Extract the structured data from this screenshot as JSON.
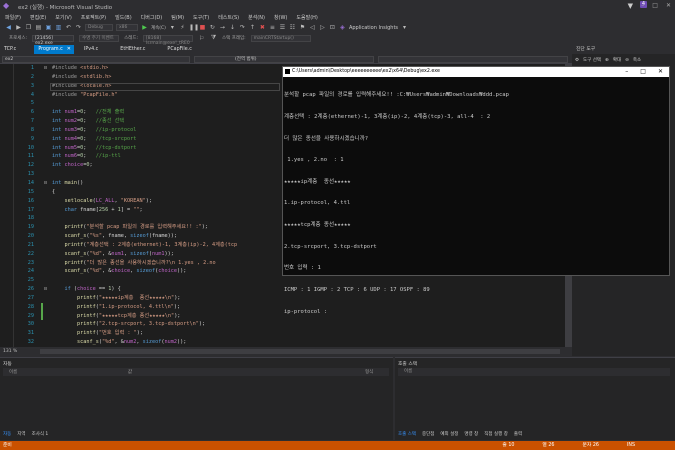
{
  "window": {
    "title": "ex2 (실행) - Microsoft Visual Studio",
    "notification_count": "4"
  },
  "menu": [
    "파일(F)",
    "편집(E)",
    "보기(V)",
    "프로젝트(P)",
    "빌드(B)",
    "디버그(D)",
    "팀(M)",
    "도구(T)",
    "테스트(S)",
    "분석(N)",
    "창(W)",
    "도움말(H)"
  ],
  "toolbar": {
    "config": "Debug",
    "platform": "x86",
    "continue_label": "계속(C)",
    "app_insights": "Application Insights"
  },
  "projbar": {
    "label": "프로세스:",
    "process": "[21456] ex2.exe",
    "lifecycle": "수명 주기 이벤트",
    "thread_label": "스레드:",
    "thread": "[8168] lsrmain@exe!_tRE0",
    "stack_label": "스택 프레임:",
    "stack": "mainCRTStartup()"
  },
  "tabs": [
    {
      "label": "TCP.c",
      "active": false
    },
    {
      "label": "Program.c",
      "active": true
    },
    {
      "label": "IPv4.c",
      "active": false
    },
    {
      "label": "EtHEther.c",
      "active": false
    },
    {
      "label": "PCapFile.c",
      "active": false
    }
  ],
  "solution_explorer": {
    "title": "진단 도구",
    "tool_select": "도구 선택",
    "zoom_in": "확대",
    "zoom_out": "축소"
  },
  "navbar": {
    "project": "ex2",
    "scope": "(전역 범위)"
  },
  "code": [
    {
      "n": "1",
      "t": "#include <stdio.h>"
    },
    {
      "n": "2",
      "t": "#include <stdlib.h>"
    },
    {
      "n": "3",
      "t": "#include <locale.h>"
    },
    {
      "n": "4",
      "t": "#include \"PcapFile.h\""
    },
    {
      "n": "5",
      "t": ""
    },
    {
      "n": "6",
      "t": "int num1=0;   //전체 출력"
    },
    {
      "n": "7",
      "t": "int num2=0;   //종선 선택"
    },
    {
      "n": "8",
      "t": "int num3=0;   //ip-protocol"
    },
    {
      "n": "9",
      "t": "int num4=0;   //tcp-srcport"
    },
    {
      "n": "10",
      "t": "int num5=0;   //tcp-dstport"
    },
    {
      "n": "11",
      "t": "int num6=0;   //ip-ttl"
    },
    {
      "n": "12",
      "t": "int choice=0;"
    },
    {
      "n": "13",
      "t": ""
    },
    {
      "n": "14",
      "t": "int main()"
    },
    {
      "n": "15",
      "t": "{"
    },
    {
      "n": "16",
      "t": "    setlocale(LC_ALL, \"KOREAN\");"
    },
    {
      "n": "17",
      "t": "    char fname[256 + 1] = \"\";"
    },
    {
      "n": "18",
      "t": ""
    },
    {
      "n": "19",
      "t": "    printf(\"분석할 pcap 파일의 경로를 입력해주세요!! :\");"
    },
    {
      "n": "20",
      "t": "    scanf_s(\"%s\", fname, sizeof(fname));"
    },
    {
      "n": "21",
      "t": "    printf(\"계층선택 : 2계층(ethernet)-1, 3계층(ip)-2, 4계층(tcp"
    },
    {
      "n": "22",
      "t": "    scanf_s(\"%d\", &num1, sizeof(num1));"
    },
    {
      "n": "23",
      "t": "    printf(\"더 많은 종선을 사용하시겠습니까?\\n 1.yes , 2.no"
    },
    {
      "n": "24",
      "t": "    scanf_s(\"%d\", &choice, sizeof(choice));"
    },
    {
      "n": "25",
      "t": ""
    },
    {
      "n": "26",
      "t": "    if (choice == 1) {"
    },
    {
      "n": "27",
      "t": "        printf(\"★★★★★ip계층  종선★★★★★\\n\");"
    },
    {
      "n": "28",
      "t": "        printf(\"1.ip-protocol, 4.ttl\\n\");"
    },
    {
      "n": "29",
      "t": "        printf(\"★★★★★tcp계층 종선★★★★★\\n\");"
    },
    {
      "n": "30",
      "t": "        printf(\"2.tcp-srcport, 3.tcp-dstport\\n\");"
    },
    {
      "n": "31",
      "t": "        printf(\"번호 입력 : \");"
    },
    {
      "n": "32",
      "t": "        scanf_s(\"%d\", &num2, sizeof(num2));"
    }
  ],
  "console": {
    "title": "C:\\Users\\admin\\Desktop\\eeeeeeeeee\\ex2\\x64\\Debug\\ex2.exe",
    "lines": [
      "분석할 pcap 파일의 경로를 입력해주세요!! :C:₩Users₩admin₩Downloads₩ddd.pcap",
      "계층선택 : 2계층(ethernet)-1, 3계층(ip)-2, 4계층(tcp)-3, all-4  : 2",
      "더 많은 종선을 사용하시겠습니까?",
      " 1.yes , 2.no  : 1",
      "★★★★★ip계층  종선★★★★★",
      "1.ip-protocol, 4.ttl",
      "★★★★★tcp계층 종선★★★★★",
      "2.tcp-srcport, 3.tcp-dstport",
      "번호 입력 : 1",
      "ICMP : 1 IGMP : 2 TCP : 6 UDP : 17 OSPF : 89",
      "ip-protocol : "
    ]
  },
  "editor_zoom": "131 %",
  "errors_panel": {
    "title": "자동",
    "col_name": "이름",
    "col_value": "값",
    "col_type": "형식",
    "tabs": [
      "자동",
      "지역",
      "조사식 1"
    ]
  },
  "output_panel": {
    "title": "호출 스택",
    "col_name": "이름",
    "tabs": [
      "호출 스택",
      "중단점",
      "예외 설정",
      "명령 창",
      "직접 실행 창",
      "출력"
    ]
  },
  "statusbar": {
    "left": "준비",
    "line": "줄 10",
    "col": "열 26",
    "ch": "문자 26",
    "mode": "INS"
  }
}
